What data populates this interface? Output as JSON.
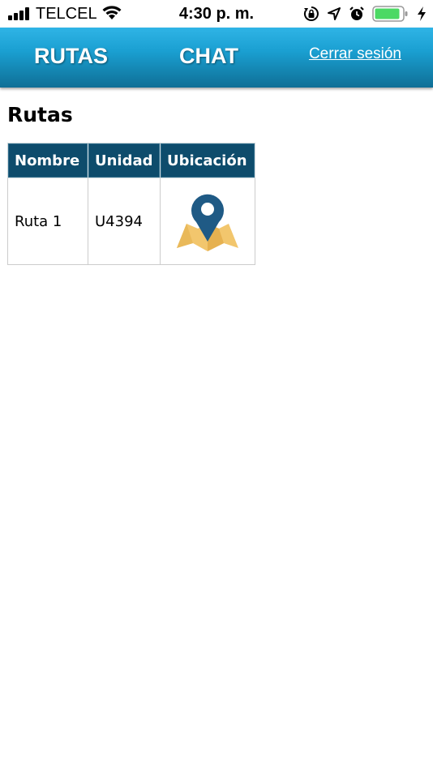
{
  "status_bar": {
    "carrier": "TELCEL",
    "time": "4:30 p. m.",
    "battery_color": "#4cd964"
  },
  "nav": {
    "rutas": "RUTAS",
    "chat": "CHAT",
    "logout": "Cerrar sesión"
  },
  "page": {
    "title": "Rutas"
  },
  "table": {
    "headers": [
      "Nombre",
      "Unidad",
      "Ubicación"
    ],
    "rows": [
      {
        "nombre": "Ruta 1",
        "unidad": "U4394",
        "ubicacion_icon": "map-pin-icon"
      }
    ]
  }
}
